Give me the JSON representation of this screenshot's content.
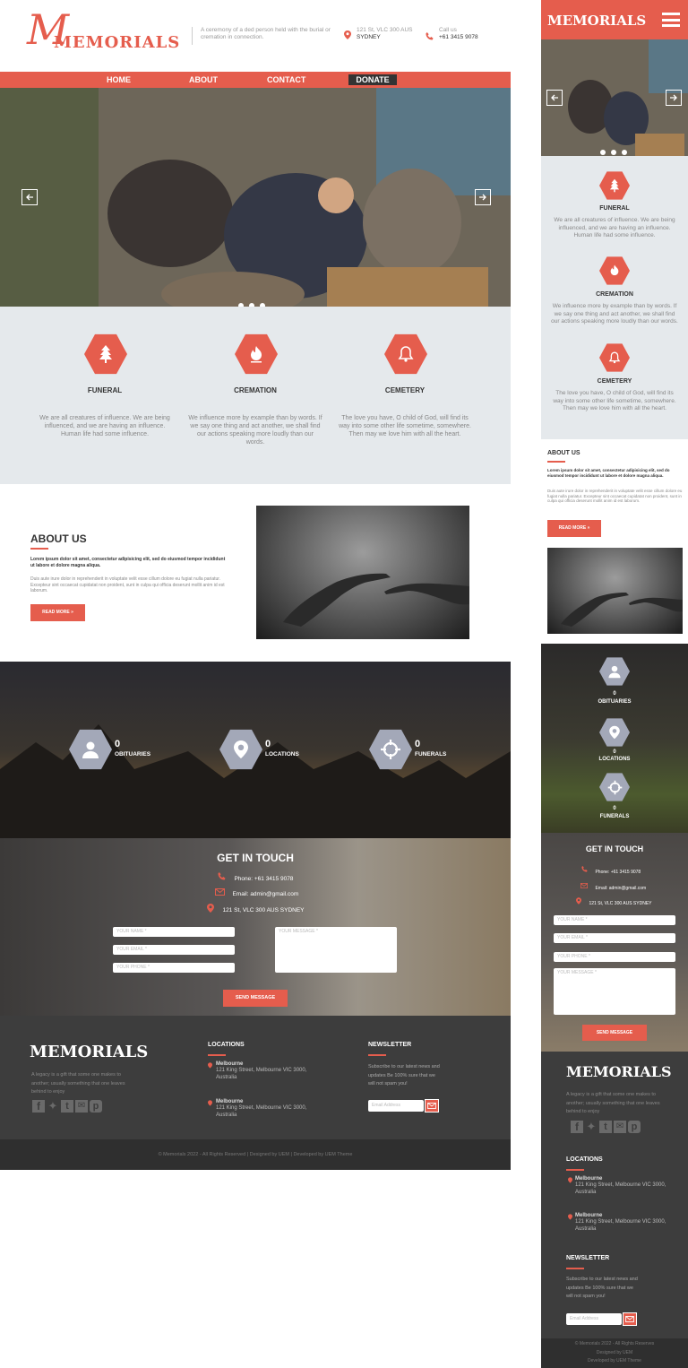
{
  "brand": {
    "logo_text": "MEMORIALS",
    "script_initial": "M",
    "tagline": "A ceremony of a ded person held with the burial or cremation in connection.",
    "address_line1": "121 St, VLC 300 AUS",
    "address_line2": "SYDNEY",
    "call_label": "Call us",
    "phone": "+61 3415 9078"
  },
  "nav": {
    "items": [
      "HOME",
      "ABOUT",
      "CONTACT",
      "DONATE"
    ]
  },
  "services": [
    {
      "title": "FUNERAL",
      "text": "We are all creatures of influence. We are being influenced, and we are having an influence. Human life had some influence."
    },
    {
      "title": "CREMATION",
      "text": "We influence more by example than by words. If we say one thing and act another, we shall find our actions speaking more loudly than our words."
    },
    {
      "title": "CEMETERY",
      "text": "The love you have, O child of God, will find its way into some other life sometime, somewhere. Then may we love him with all the heart."
    }
  ],
  "mobile_services": [
    {
      "title": "FUNERAL",
      "text": "We are all creatures of influence. We are being influenced, and we are having an influence. Human life had some influence."
    },
    {
      "title": "CREMATION",
      "text": "We influence more by example than by words. If we say one thing and act another, we shall find our actions speaking more loudly than our words."
    },
    {
      "title": "CEMETERY",
      "text": "The love you have, O child of God, will find its way into some other life sometime, somewhere. Then may we love him with all the heart."
    }
  ],
  "about": {
    "heading": "ABOUT US",
    "lead": "Lorem ipsum dolor sit amet, consectetur adipisicing elit, sed do eiusmod tempor incididunt ut labore et dolore magna aliqua.",
    "body": "Duis aute irure dolor in reprehenderit in voluptate velit esse cillum dolore eu fugiat nulla pariatur. Excepteur sint occaecat cupidatat non proident, sunt in culpa qui officia deserunt mollit anim id est laborum.",
    "button": "READ MORE »"
  },
  "stats": [
    {
      "value": "0",
      "label": "OBITUARIES"
    },
    {
      "value": "0",
      "label": "LOCATIONS"
    },
    {
      "value": "0",
      "label": "FUNERALS"
    }
  ],
  "contact": {
    "heading": "GET IN TOUCH",
    "phone": "Phone: +61 3415 9078",
    "email": "Email: admin@gmail.com",
    "address": "121 St, VLC 300 AUS SYDNEY",
    "name_ph": "YOUR NAME *",
    "email_ph": "YOUR EMAIL *",
    "phone_ph": "YOUR PHONE *",
    "message_ph": "YOUR MESSAGE *",
    "send": "SEND MESSAGE"
  },
  "footer": {
    "logo": "MEMORIALS",
    "blurb": "A legacy is a gift that some one makes to another; usually something that one leaves behind to enjoy",
    "locations_title": "LOCATIONS",
    "loc1_city": "Melbourne",
    "loc1_addr": "121 King Street, Melbourne VIC 3000, Australia",
    "loc2_city": "Melbourne",
    "loc2_addr": "121 King Street, Melbourne VIC 3000, Australia",
    "newsletter_title": "NEWSLETTER",
    "newsletter_text": "Subscribe to our latest news and updates Be 100% sure that we will not spam you!",
    "email_ph": "Email Address",
    "copyright": "© Memorials 2022 - All Rights Reserved | Designed by UEM | Developed by UEM Theme",
    "m_copy1": "© Memorials 2022 - All Rights Reserves",
    "m_copy2": "Designed by UEM",
    "m_copy3": "Developed by UEM Theme"
  },
  "mobile": {
    "logo": "MEMORIALS"
  },
  "colors": {
    "accent": "#e55d4d",
    "light_bg": "#e5e9ec",
    "dark": "#3d3d3d",
    "hex_gray": "#a3a8b8"
  }
}
